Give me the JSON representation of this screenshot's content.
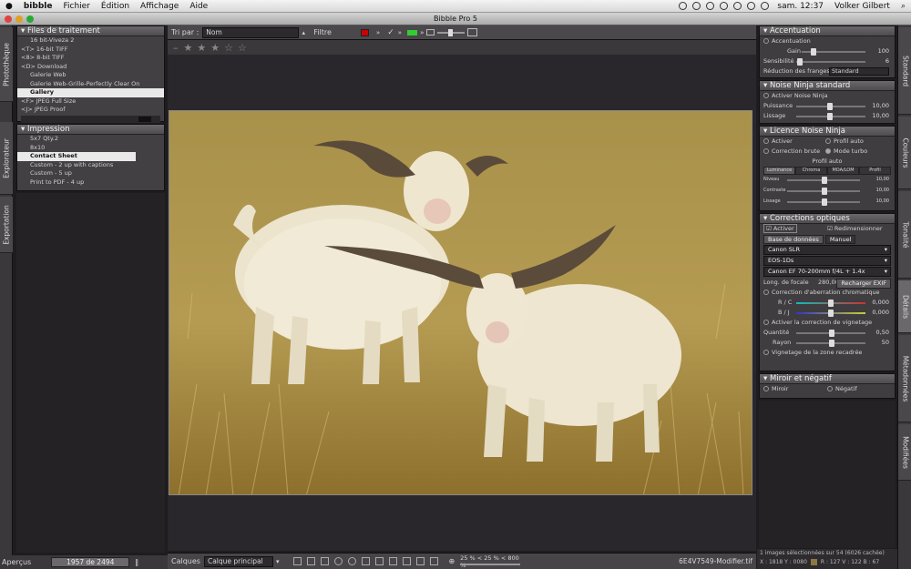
{
  "menubar": {
    "app": "bibble",
    "items": [
      "Fichier",
      "Édition",
      "Affichage",
      "Aide"
    ],
    "clock": "sam. 12:37",
    "user": "Volker Gilbert"
  },
  "window": {
    "title": "Bibble Pro 5"
  },
  "lefttabs": [
    "Photothèque",
    "Explorateur",
    "Exportation"
  ],
  "righttabs": [
    "Standard",
    "Couleurs",
    "Tonalité",
    "Détails",
    "Métadonnées",
    "Modifiées"
  ],
  "files_panel": {
    "title": "Files de traitement",
    "items": [
      {
        "label": "16 bit-Viveza 2",
        "selected": false
      },
      {
        "label": "<T>  16-bit TIFF",
        "selected": false
      },
      {
        "label": "<8>  8-bit TIFF",
        "selected": false
      },
      {
        "label": "<D>  Download",
        "selected": false
      },
      {
        "label": "Galerie Web",
        "selected": false
      },
      {
        "label": "Galerie Web-Grille-Perfectly Clear On",
        "selected": false
      },
      {
        "label": "Gallery",
        "selected": true
      },
      {
        "label": "<F>  JPEG Full Size",
        "selected": false
      },
      {
        "label": "<J>  JPEG Proof",
        "selected": false
      }
    ]
  },
  "print_panel": {
    "title": "Impression",
    "items": [
      {
        "label": "5x7 Qty.2",
        "selected": false
      },
      {
        "label": "8x10",
        "selected": false
      },
      {
        "label": "Contact Sheet",
        "selected": true
      },
      {
        "label": "Custom - 2 up with captions",
        "selected": false
      },
      {
        "label": "Custom - 5 up",
        "selected": false
      },
      {
        "label": "Print to PDF - 4 up",
        "selected": false
      }
    ]
  },
  "toolbar": {
    "sort_label": "Tri par :",
    "sort_value": "Nom",
    "filter": "Filtre"
  },
  "rating": {
    "stars": 0,
    "max": 5
  },
  "bottom": {
    "apercus": "Aperçus",
    "counter": "1957 de 2494",
    "layers": "Calques",
    "layer_value": "Calque principal",
    "zoom": "25 % < 25 % < 800 %",
    "filename": "6E4V7549-Modifier.tif",
    "selinfo": "1 images sélectionnées sur 54 (6026 cachée)",
    "coords": "X : 1818  Y : 0080",
    "rgb": "R : 127  V : 122  B : 67"
  },
  "accentuation": {
    "title": "Accentuation",
    "enable": "Accentuation",
    "gain_label": "Gain",
    "gain_value": "100",
    "sens_label": "Sensibilité",
    "sens_value": "6",
    "frange_label": "Réduction des franges",
    "frange_value": "Standard"
  },
  "noise": {
    "title": "Noise Ninja standard",
    "enable": "Activer Noise Ninja",
    "power_label": "Puissance",
    "power_value": "10,00",
    "smooth_label": "Lissage",
    "smooth_value": "10,00"
  },
  "noiselic": {
    "title": "Licence Noise Ninja",
    "activate": "Activer",
    "profil_auto": "Profil auto",
    "correction": "Correction brute",
    "turbo": "Mode turbo",
    "profil": "Profil auto",
    "tabs": [
      "Luminance",
      "Chroma",
      "MOA/LOM",
      "Profil"
    ],
    "rows": [
      {
        "label": "Niveau",
        "value": "10,00"
      },
      {
        "label": "Contraste",
        "value": "10,00"
      },
      {
        "label": "Lissage",
        "value": "10,00"
      }
    ]
  },
  "optics": {
    "title": "Corrections optiques",
    "activate": "Activer",
    "resize": "Redimensionner",
    "db": "Base de données",
    "manual": "Manuel",
    "camera": "Canon SLR",
    "body": "EOS-1Ds",
    "lens": "Canon EF 70-200mm f/4L + 1.4x",
    "focal_label": "Long. de focale",
    "focal_value": "280,00",
    "exif": "Recharger EXIF",
    "aberration": "Correction d'aberration chromatique",
    "rc_label": "R / C",
    "rc_value": "0,000",
    "bj_label": "B / J",
    "bj_value": "0,000",
    "vignette": "Activer la correction de vignetage",
    "qty_label": "Quantité",
    "qty_value": "0,50",
    "radius_label": "Rayon",
    "radius_value": "50",
    "vigzone": "Vignetage de la zone recadrée"
  },
  "mirror": {
    "title": "Miroir et négatif",
    "mirror": "Miroir",
    "negative": "Négatif"
  }
}
